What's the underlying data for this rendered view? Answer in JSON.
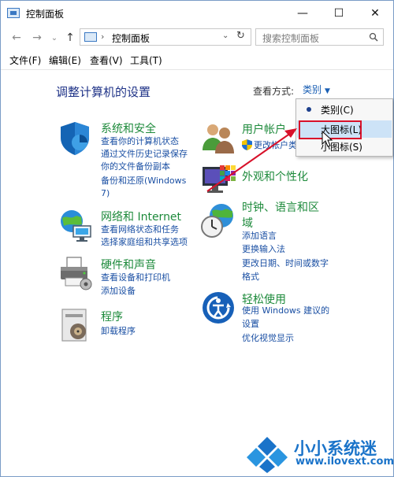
{
  "window": {
    "title": "控制面板",
    "controls": {
      "minimize": "—",
      "maximize": "☐",
      "close": "✕"
    }
  },
  "nav": {
    "back": "←",
    "forward": "→",
    "recent": "⌄",
    "up": "↑",
    "address_separator": "›",
    "address": "控制面板",
    "address_dropdown": "⌄",
    "refresh": "↻",
    "search_placeholder": "搜索控制面板"
  },
  "menu": [
    "文件(F)",
    "编辑(E)",
    "查看(V)",
    "工具(T)"
  ],
  "main": {
    "heading": "调整计算机的设置",
    "view_by_label": "查看方式:",
    "view_by_value": "类别"
  },
  "categories": [
    {
      "title": "系统和安全",
      "icon": "shield-icon",
      "links": [
        "查看你的计算机状态",
        "通过文件历史记录保存",
        "你的文件备份副本",
        "备份和还原(Windows",
        "7)"
      ]
    },
    {
      "title": "网络和 Internet",
      "icon": "network-globe-icon",
      "links": [
        "查看网络状态和任务",
        "选择家庭组和共享选项"
      ]
    },
    {
      "title": "硬件和声音",
      "icon": "printer-icon",
      "links": [
        "查看设备和打印机",
        "添加设备"
      ]
    },
    {
      "title": "程序",
      "icon": "programs-icon",
      "links": [
        "卸载程序"
      ]
    },
    {
      "title": "用户帐户",
      "icon": "users-icon",
      "links": [
        "更改帐户类"
      ]
    },
    {
      "title": "外观和个性化",
      "icon": "monitor-palette-icon",
      "links": []
    },
    {
      "title": "时钟、语言和区",
      "title2": "域",
      "icon": "clock-globe-icon",
      "links": [
        "添加语言",
        "更换输入法",
        "更改日期、时间或数字",
        "格式"
      ]
    },
    {
      "title": "轻松使用",
      "icon": "ease-of-access-icon",
      "links": [
        "使用 Windows 建议的",
        "设置",
        "优化视觉显示"
      ]
    }
  ],
  "dropdown": {
    "items": [
      "类别(C)",
      "大图标(L)",
      "小图标(S)"
    ],
    "selected": 0,
    "hovered": 1
  },
  "watermark": {
    "name": "小小系统迷",
    "url": "www.ilovext.com"
  },
  "colors": {
    "category_title": "#1d8a3b",
    "link": "#1a4fa3",
    "heading": "#1e3287",
    "highlight": "#d8112a",
    "hover": "#cde3f7"
  }
}
